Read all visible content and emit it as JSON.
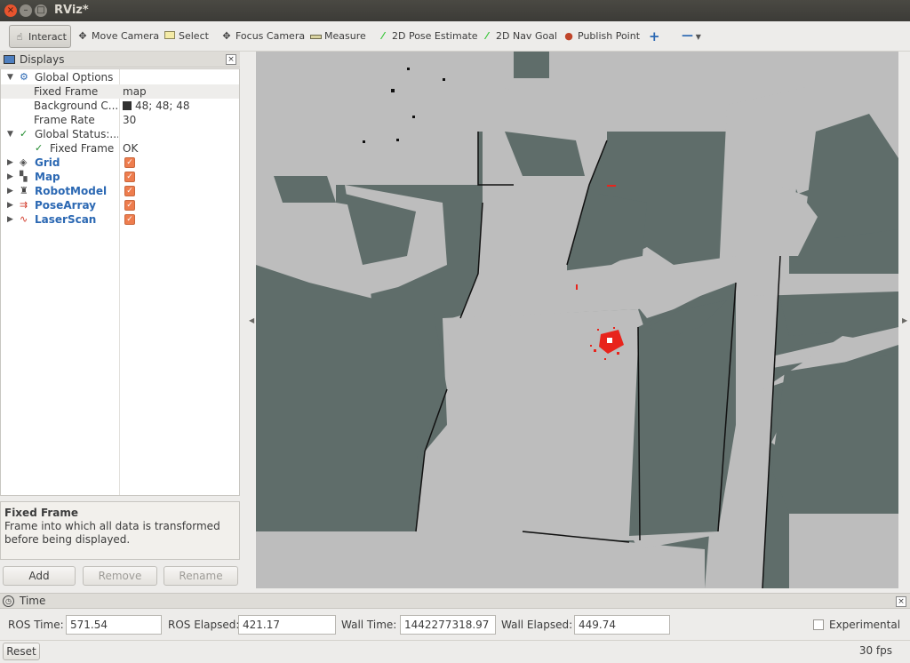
{
  "window": {
    "title": "RViz*"
  },
  "toolbar": {
    "interact": "Interact",
    "move_camera": "Move Camera",
    "select": "Select",
    "focus_camera": "Focus Camera",
    "measure": "Measure",
    "pose_estimate": "2D Pose Estimate",
    "nav_goal": "2D Nav Goal",
    "publish_point": "Publish Point"
  },
  "displays": {
    "title": "Displays",
    "rows": [
      {
        "name": "Global Options",
        "value": ""
      },
      {
        "name": "Fixed Frame",
        "value": "map"
      },
      {
        "name": "Background C...",
        "value": "48; 48; 48"
      },
      {
        "name": "Frame Rate",
        "value": "30"
      },
      {
        "name": "Global Status:...",
        "value": ""
      },
      {
        "name": "Fixed Frame",
        "value": "OK"
      },
      {
        "name": "Grid",
        "value": ""
      },
      {
        "name": "Map",
        "value": ""
      },
      {
        "name": "RobotModel",
        "value": ""
      },
      {
        "name": "PoseArray",
        "value": ""
      },
      {
        "name": "LaserScan",
        "value": ""
      }
    ],
    "help_title": "Fixed Frame",
    "help_text": "Frame into which all data is transformed before being displayed.",
    "add": "Add",
    "remove": "Remove",
    "rename": "Rename"
  },
  "time": {
    "title": "Time",
    "ros_time_label": "ROS Time:",
    "ros_time": "571.54",
    "ros_elapsed_label": "ROS Elapsed:",
    "ros_elapsed": "421.17",
    "wall_time_label": "Wall Time:",
    "wall_time": "1442277318.97",
    "wall_elapsed_label": "Wall Elapsed:",
    "wall_elapsed": "449.74",
    "experimental": "Experimental"
  },
  "status": {
    "reset": "Reset",
    "fps": "30 fps"
  },
  "colors": {
    "map_free": "#bdbdbd",
    "map_unknown": "#5f6d6a",
    "laser": "#e8241c",
    "accent": "#2b68b3"
  }
}
